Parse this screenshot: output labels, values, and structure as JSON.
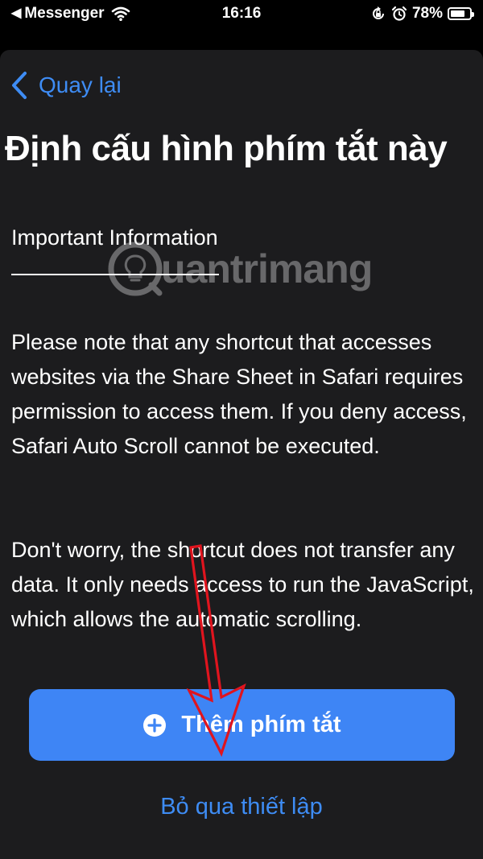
{
  "status_bar": {
    "back_glyph": "◀",
    "carrier": "Messenger",
    "time": "16:16",
    "battery": "78%",
    "battery_level": 0.78,
    "icons": [
      "wifi-icon",
      "orientation-lock-icon",
      "alarm-icon",
      "battery-icon"
    ]
  },
  "nav": {
    "back_label": "Quay lại"
  },
  "page": {
    "title": "Định cấu hình phím tắt này",
    "info_heading": "Important Information",
    "paragraph_1": "Please note that any shortcut that accesses websites via the Share Sheet in Safari requires permission to access them. If you deny access, Safari Auto Scroll cannot be executed.",
    "paragraph_2": "Don't worry, the shortcut does not transfer any data. It only needs access to run the JavaScript, which allows the automatic scrolling."
  },
  "actions": {
    "add_shortcut_label": "Thêm phím tắt",
    "skip_setup_label": "Bỏ qua thiết lập"
  },
  "watermark": {
    "text": "uantrimang"
  },
  "colors": {
    "background": "#1c1c1e",
    "accent": "#3e8cf4",
    "button": "#3e85f5",
    "annotation": "#e0141e"
  }
}
